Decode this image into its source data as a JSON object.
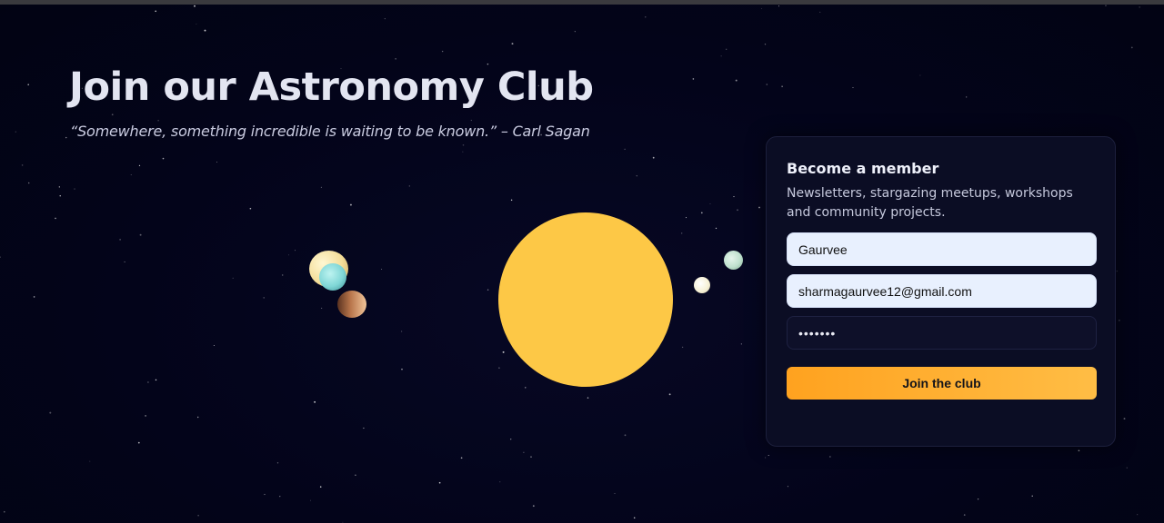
{
  "hero": {
    "title": "Join our Astronomy Club",
    "quote": "“Somewhere, something incredible is waiting to be known.” – Carl Sagan"
  },
  "form": {
    "title": "Become a member",
    "subtitle": "Newsletters, stargazing meetups, workshops and community projects.",
    "name_value": "Gaurvee",
    "email_value": "sharmagaurvee12@gmail.com",
    "password_value": "•••••••",
    "submit_label": "Join the club"
  },
  "colors": {
    "background": "#03041a",
    "accent": "#ffa21f",
    "sun": "#fdc846",
    "card": "#0b0d24"
  }
}
